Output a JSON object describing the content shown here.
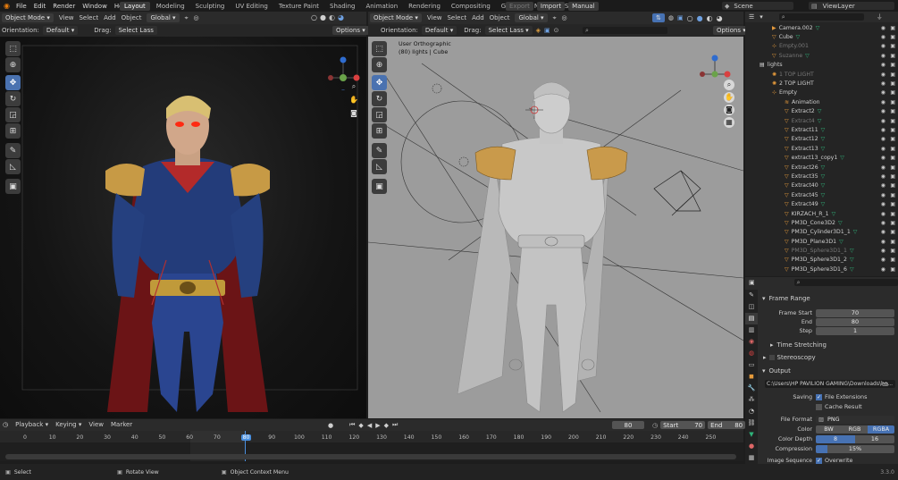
{
  "topbar": {
    "menu": [
      "File",
      "Edit",
      "Render",
      "Window",
      "Help"
    ],
    "workspaces": [
      "Layout",
      "Modeling",
      "Sculpting",
      "UV Editing",
      "Texture Paint",
      "Shading",
      "Animation",
      "Rendering",
      "Compositing",
      "Geometry Nodes",
      "Scripting"
    ],
    "active_workspace": "Layout",
    "export": "Export",
    "import": "Import",
    "manual": "Manual",
    "scene": "Scene",
    "view_layer": "ViewLayer"
  },
  "left_viewport": {
    "mode": "Object Mode",
    "menus": [
      "View",
      "Select",
      "Add",
      "Object"
    ],
    "transform": "Global",
    "orientation_label": "Orientation:",
    "orientation_value": "Default",
    "drag_label": "Drag:",
    "drag_value": "Select Lass",
    "options": "Options"
  },
  "right_viewport": {
    "mode": "Object Mode",
    "menus": [
      "View",
      "Select",
      "Add",
      "Object"
    ],
    "transform": "Global",
    "orientation_label": "Orientation:",
    "orientation_value": "Default",
    "drag_label": "Drag:",
    "drag_value": "Select Lass",
    "options": "Options",
    "overlay_line1": "User Orthographic",
    "overlay_line2": "(80) lights | Cube"
  },
  "outliner": {
    "items": [
      {
        "name": "Camera.002",
        "icon": "camera-icon",
        "dim": false
      },
      {
        "name": "Cube",
        "icon": "mesh-icon",
        "dim": false
      },
      {
        "name": "Empty.001",
        "icon": "empty-icon",
        "dim": true
      },
      {
        "name": "Suzanne",
        "icon": "mesh-icon",
        "dim": true
      },
      {
        "name": "lights",
        "icon": "collection-icon",
        "dim": false
      },
      {
        "name": "1 TOP LIGHT",
        "icon": "light-icon",
        "dim": true
      },
      {
        "name": "2 TOP LIGHT",
        "icon": "light-icon",
        "dim": false
      },
      {
        "name": "Empty",
        "icon": "empty-icon",
        "dim": false
      },
      {
        "name": "Animation",
        "icon": "action-icon",
        "dim": false
      },
      {
        "name": "Extract2",
        "icon": "mesh-icon",
        "dim": false
      },
      {
        "name": "Extract4",
        "icon": "mesh-icon",
        "dim": true
      },
      {
        "name": "Extract11",
        "icon": "mesh-icon",
        "dim": false
      },
      {
        "name": "Extract12",
        "icon": "mesh-icon",
        "dim": false
      },
      {
        "name": "Extract13",
        "icon": "mesh-icon",
        "dim": false
      },
      {
        "name": "extract13_copy1",
        "icon": "mesh-icon",
        "dim": false
      },
      {
        "name": "Extract26",
        "icon": "mesh-icon",
        "dim": false
      },
      {
        "name": "Extract35",
        "icon": "mesh-icon",
        "dim": false
      },
      {
        "name": "Extract40",
        "icon": "mesh-icon",
        "dim": false
      },
      {
        "name": "Extract45",
        "icon": "mesh-icon",
        "dim": false
      },
      {
        "name": "Extract49",
        "icon": "mesh-icon",
        "dim": false
      },
      {
        "name": "KIRZACH_R_1",
        "icon": "mesh-icon",
        "dim": false
      },
      {
        "name": "PM3D_Cone3D2",
        "icon": "mesh-icon",
        "dim": false
      },
      {
        "name": "PM3D_Cylinder3D1_1",
        "icon": "mesh-icon",
        "dim": false
      },
      {
        "name": "PM3D_Plane3D1",
        "icon": "mesh-icon",
        "dim": false
      },
      {
        "name": "PM3D_Sphere3D1_1",
        "icon": "mesh-icon",
        "dim": true
      },
      {
        "name": "PM3D_Sphere3D1_2",
        "icon": "mesh-icon",
        "dim": false
      },
      {
        "name": "PM3D_Sphere3D1_6",
        "icon": "mesh-icon",
        "dim": false
      }
    ]
  },
  "properties": {
    "frame_range": "Frame Range",
    "frame_start_label": "Frame Start",
    "frame_start": "70",
    "end_label": "End",
    "end": "80",
    "step_label": "Step",
    "step": "1",
    "time_stretching": "Time Stretching",
    "stereoscopy": "Stereoscopy",
    "output": "Output",
    "output_path": "C:\\Users\\HP PAVILION GAMING\\Downloads\\ho...",
    "saving_label": "Saving",
    "file_extensions": "File Extensions",
    "cache_result": "Cache Result",
    "file_format_label": "File Format",
    "file_format": "PNG",
    "color_label": "Color",
    "color_options": [
      "BW",
      "RGB",
      "RGBA"
    ],
    "color_active": "RGBA",
    "color_depth_label": "Color Depth",
    "color_depth_options": [
      "8",
      "16"
    ],
    "compression_label": "Compression",
    "compression": "15%",
    "compression_fraction": 0.15,
    "image_sequence_label": "Image Sequence",
    "overwrite": "Overwrite"
  },
  "timeline": {
    "menus": [
      "Playback",
      "Keying",
      "View",
      "Marker"
    ],
    "current_frame": "80",
    "start_label": "Start",
    "start": "70",
    "end_label": "End",
    "end": "80",
    "ticks": [
      "0",
      "10",
      "20",
      "30",
      "40",
      "50",
      "60",
      "70",
      "80",
      "90",
      "100",
      "110",
      "120",
      "130",
      "140",
      "150",
      "160",
      "170",
      "180",
      "190",
      "200",
      "210",
      "220",
      "230",
      "240",
      "250"
    ]
  },
  "statusbar": {
    "select": "Select",
    "rotate_view": "Rotate View",
    "object_context_menu": "Object Context Menu",
    "version": "3.3.0"
  }
}
